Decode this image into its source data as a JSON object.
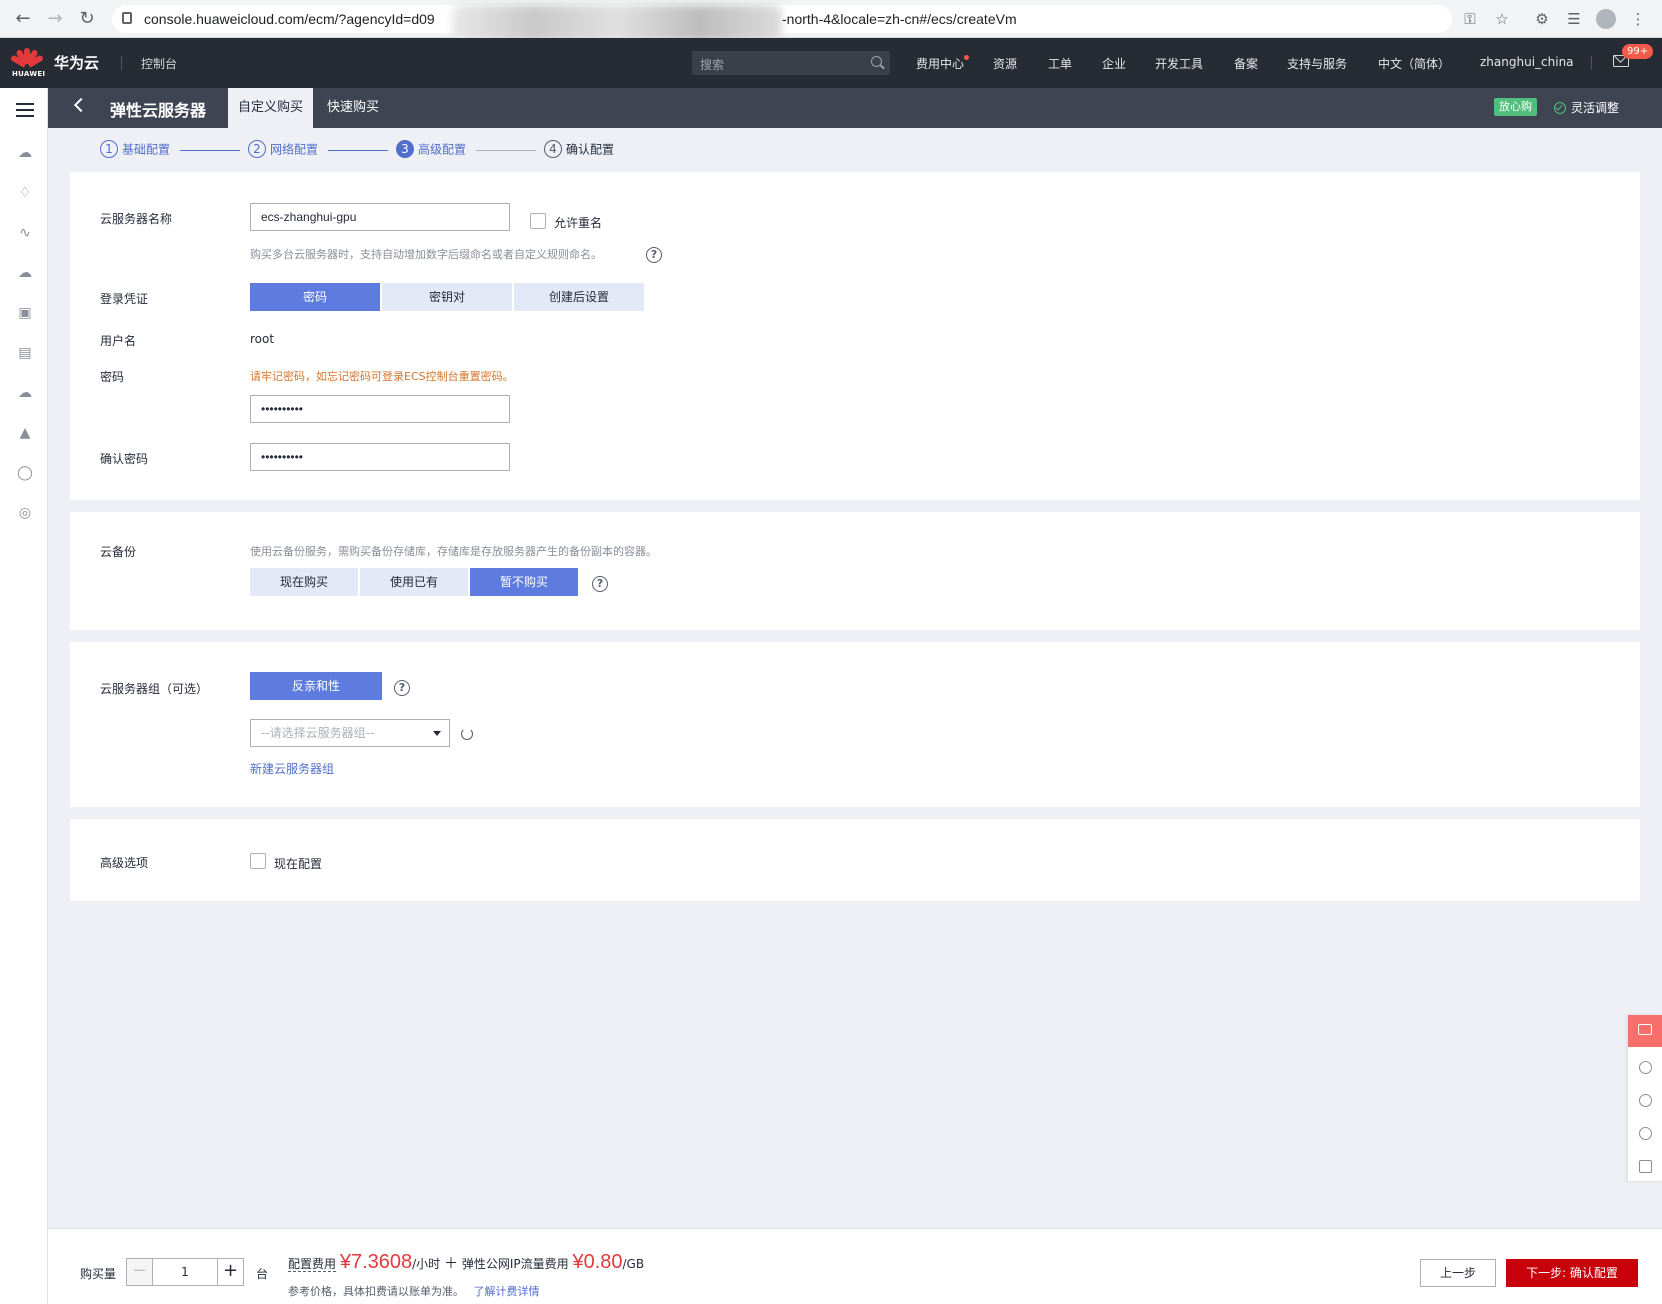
{
  "browser": {
    "url_prefix": "console.huaweicloud.com/ecm/?agencyId=d09",
    "url_suffix": "-north-4&locale=zh-cn#/ecs/createVm"
  },
  "topbar": {
    "logo_text": "HUAWEI",
    "brand": "华为云",
    "console": "控制台",
    "search_placeholder": "搜索",
    "nav": [
      "费用中心",
      "资源",
      "工单",
      "企业",
      "开发工具",
      "备案",
      "支持与服务",
      "中文（简体）",
      "zhanghui_china"
    ],
    "mail_badge": "99+"
  },
  "subheader": {
    "title": "弹性云服务器",
    "tabs": [
      "自定义购买",
      "快速购买"
    ],
    "badge": "放心购",
    "flex_adjust": "灵活调整"
  },
  "steps": [
    {
      "num": "1",
      "label": "基础配置"
    },
    {
      "num": "2",
      "label": "网络配置"
    },
    {
      "num": "3",
      "label": "高级配置"
    },
    {
      "num": "4",
      "label": "确认配置"
    }
  ],
  "form": {
    "name_label": "云服务器名称",
    "name_value": "ecs-zhanghui-gpu",
    "allow_dup": "允许重名",
    "name_hint": "购买多台云服务器时，支持自动增加数字后缀命名或者自定义规则命名。",
    "login_label": "登录凭证",
    "login_options": [
      "密码",
      "密钥对",
      "创建后设置"
    ],
    "user_label": "用户名",
    "user_value": "root",
    "pwd_label": "密码",
    "pwd_warning": "请牢记密码，如忘记密码可登录ECS控制台重置密码。",
    "pwd_value": "••••••••••",
    "confirm_label": "确认密码",
    "confirm_value": "••••••••••"
  },
  "backup": {
    "label": "云备份",
    "hint": "使用云备份服务，需购买备份存储库，存储库是存放服务器产生的备份副本的容器。",
    "options": [
      "现在购买",
      "使用已有",
      "暂不购买"
    ]
  },
  "group": {
    "label": "云服务器组（可选）",
    "button": "反亲和性",
    "select_placeholder": "--请选择云服务器组--",
    "new_link": "新建云服务器组"
  },
  "advanced": {
    "label": "高级选项",
    "checkbox": "现在配置"
  },
  "footer": {
    "qty_label": "购买量",
    "qty_value": "1",
    "unit": "台",
    "config_fee": "配置费用",
    "config_price": "¥7.3608",
    "per_hour": "/小时",
    "plus": "＋",
    "ip_fee": "弹性公网IP流量费用",
    "ip_price": "¥0.80",
    "per_gb": "/GB",
    "ref_note": "参考价格，具体扣费请以账单为准。",
    "detail_link": "了解计费详情",
    "prev": "上一步",
    "next": "下一步: 确认配置"
  }
}
